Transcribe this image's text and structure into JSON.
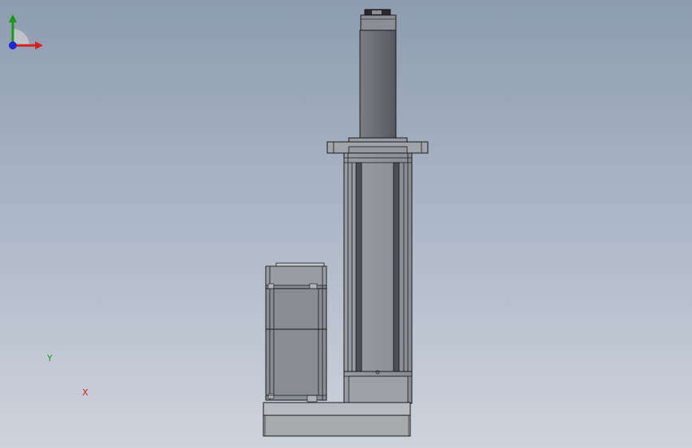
{
  "viewport": {
    "background_top": "#8e9cb0",
    "background_bottom": "#cdd3dc"
  },
  "model": {
    "parts": [
      "base-plate",
      "motor",
      "actuator-housing",
      "mounting-flange",
      "piston-rod",
      "rod-end"
    ],
    "body_color": "#8e9099",
    "rod_color": "#6b6d73",
    "edge_color": "#1a1a1a"
  },
  "triad": {
    "x_label": "X",
    "y_label": "Y",
    "x_color": "#d42020",
    "y_color": "#1a9a1a",
    "z_color": "#1e2ad0"
  }
}
